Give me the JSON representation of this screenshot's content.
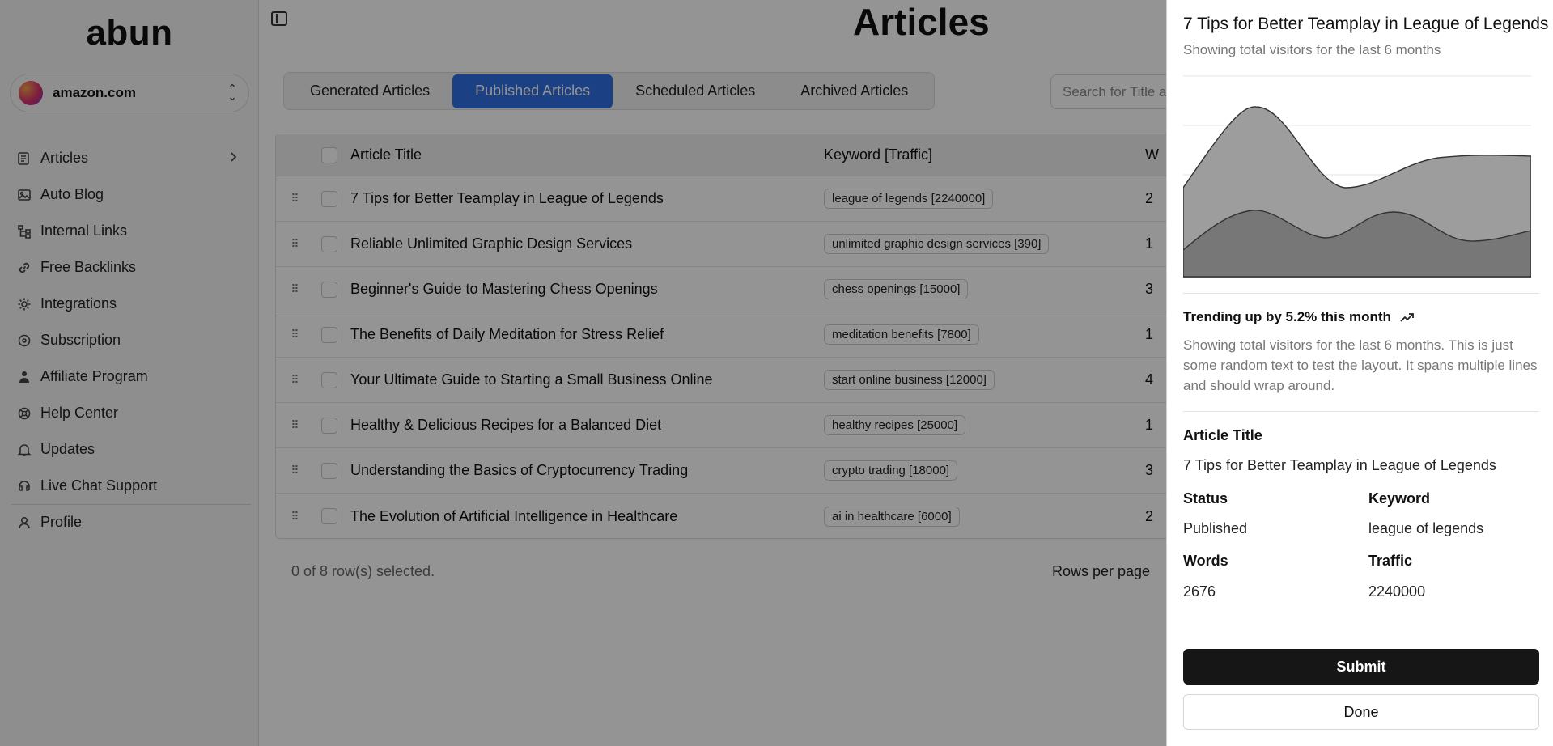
{
  "sidebar": {
    "brand": "abun",
    "site": "amazon.com",
    "items": [
      {
        "label": "Articles",
        "icon": "articles-icon"
      },
      {
        "label": "Auto Blog",
        "icon": "image-icon"
      },
      {
        "label": "Internal Links",
        "icon": "sitemap-icon"
      },
      {
        "label": "Free Backlinks",
        "icon": "link-icon"
      },
      {
        "label": "Integrations",
        "icon": "gear-icon"
      },
      {
        "label": "Subscription",
        "icon": "disc-icon"
      },
      {
        "label": "Affiliate Program",
        "icon": "users-icon"
      },
      {
        "label": "Help Center",
        "icon": "help-icon"
      },
      {
        "label": "Updates",
        "icon": "bell-icon"
      },
      {
        "label": "Live Chat Support",
        "icon": "chat-icon"
      },
      {
        "label": "Profile",
        "icon": "user-icon"
      }
    ]
  },
  "main": {
    "title": "Articles",
    "tabs": [
      "Generated Articles",
      "Published Articles",
      "Scheduled Articles",
      "Archived Articles"
    ],
    "active_tab": "Published Articles",
    "search_placeholder": "Search for Title a",
    "columns": {
      "title": "Article Title",
      "keyword": "Keyword [Traffic]",
      "words": "W"
    },
    "rows": [
      {
        "title": "7 Tips for Better Teamplay in League of Legends",
        "keyword": "league of legends [2240000]",
        "words": "2"
      },
      {
        "title": "Reliable Unlimited Graphic Design Services",
        "keyword": "unlimited graphic design services [390]",
        "words": "1"
      },
      {
        "title": "Beginner's Guide to Mastering Chess Openings",
        "keyword": "chess openings [15000]",
        "words": "3"
      },
      {
        "title": "The Benefits of Daily Meditation for Stress Relief",
        "keyword": "meditation benefits [7800]",
        "words": "1"
      },
      {
        "title": "Your Ultimate Guide to Starting a Small Business Online",
        "keyword": "start online business [12000]",
        "words": "4"
      },
      {
        "title": "Healthy & Delicious Recipes for a Balanced Diet",
        "keyword": "healthy recipes [25000]",
        "words": "1"
      },
      {
        "title": "Understanding the Basics of Cryptocurrency Trading",
        "keyword": "crypto trading [18000]",
        "words": "3"
      },
      {
        "title": "The Evolution of Artificial Intelligence in Healthcare",
        "keyword": "ai in healthcare [6000]",
        "words": "2"
      }
    ],
    "selection_text": "0 of 8 row(s) selected.",
    "rows_per_page_label": "Rows per page"
  },
  "drawer": {
    "title": "7 Tips for Better Teamplay in League of Legends",
    "subtitle": "Showing total visitors for the last 6 months",
    "trend_text": "Trending up by 5.2% this month",
    "description": "Showing total visitors for the last 6 months. This is just some random text to test the layout. It spans multiple lines and should wrap around.",
    "article_title_label": "Article Title",
    "article_title_value": "7 Tips for Better Teamplay in League of Legends",
    "status_label": "Status",
    "status_value": "Published",
    "keyword_label": "Keyword",
    "keyword_value": "league of legends",
    "words_label": "Words",
    "words_value": "2676",
    "traffic_label": "Traffic",
    "traffic_value": "2240000",
    "submit_label": "Submit",
    "done_label": "Done"
  },
  "colors": {
    "accent": "#2f6fe4",
    "overlay": "rgba(0,0,0,0.42)",
    "button_dark": "#161616"
  }
}
